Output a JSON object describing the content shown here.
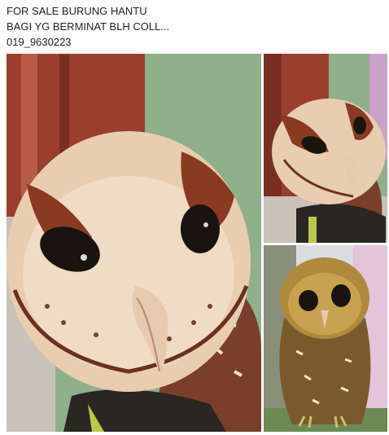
{
  "post": {
    "lines": [
      "FOR SALE BURUNG HANTU",
      "BAGI YG BERMINAT BLH COLL...",
      "019_9630223"
    ]
  },
  "photos": [
    {
      "subject": "owl-closeup"
    },
    {
      "subject": "owl-side-view"
    },
    {
      "subject": "owl-full-body"
    }
  ],
  "colors": {
    "text": "#1d2129",
    "wall_green": "#8fb08a",
    "door_red": "#8a3a2c",
    "owl_face": "#e8cdb0",
    "owl_brown": "#7a3f2a",
    "glove_dark": "#2a2622"
  }
}
